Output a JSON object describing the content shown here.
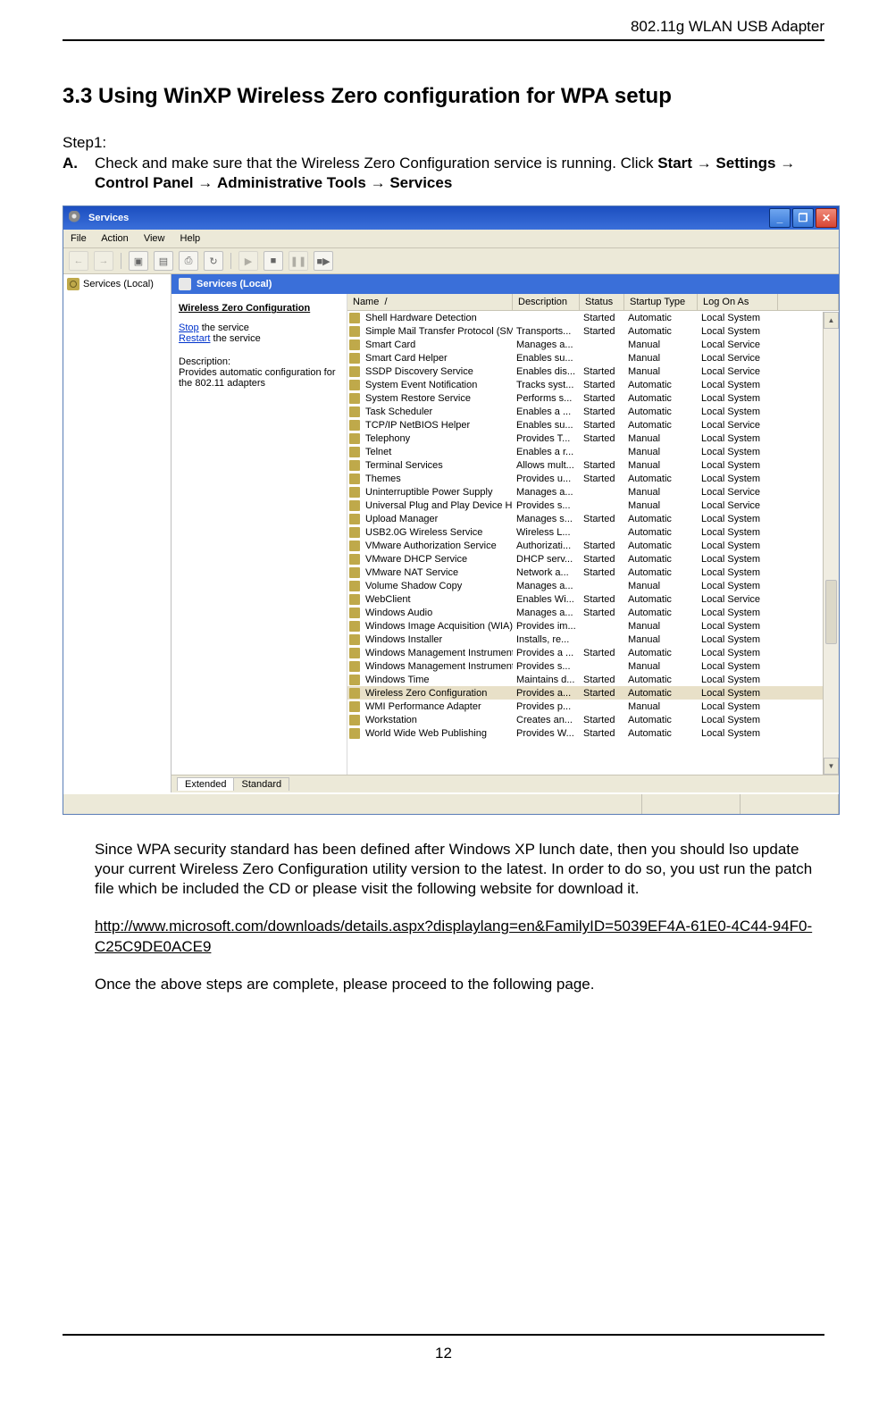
{
  "doc": {
    "header_right": "802.11g WLAN USB Adapter",
    "section_title": "3.3 Using WinXP Wireless Zero configuration for WPA setup",
    "step_label": "Step1:",
    "bullet": "A.",
    "instr_prefix": "Check and make sure that the Wireless Zero Configuration service is running. Click ",
    "path1": "Start",
    "arrow": "→",
    "path2": "Settings",
    "path3": "Control Panel",
    "path4": "Administrative Tools",
    "path5": "Services",
    "para2": "Since WPA security standard has been defined after Windows XP lunch date, then you should lso update your current Wireless Zero Configuration utility version to the latest. In order to do so, you ust run the patch file which be included the CD or please visit the following website for download it.",
    "url": "http://www.microsoft.com/downloads/details.aspx?displaylang=en&FamilyID=5039EF4A-61E0-4C44-94F0-C25C9DE0ACE9",
    "para3": "Once the above steps are complete, please proceed to the following page.",
    "page_number": "12"
  },
  "win": {
    "title": "Services",
    "menu": {
      "file": "File",
      "action": "Action",
      "view": "View",
      "help": "Help"
    },
    "tree_label": "Services (Local)",
    "panel_title": "Services (Local)",
    "info": {
      "selected": "Wireless Zero Configuration",
      "link_stop": "Stop",
      "link_stop_suffix": " the service",
      "link_restart": "Restart",
      "link_restart_suffix": " the service",
      "desc_label": "Description:",
      "desc_text": "Provides automatic configuration for the 802.11 adapters"
    },
    "columns": {
      "name": "Name",
      "sort": "/",
      "desc": "Description",
      "status": "Status",
      "startup": "Startup Type",
      "logon": "Log On As"
    },
    "tabs": {
      "extended": "Extended",
      "standard": "Standard"
    },
    "services": [
      {
        "name": "Shell Hardware Detection",
        "desc": "",
        "status": "Started",
        "startup": "Automatic",
        "logon": "Local System"
      },
      {
        "name": "Simple Mail Transfer Protocol (SMTP)",
        "desc": "Transports...",
        "status": "Started",
        "startup": "Automatic",
        "logon": "Local System"
      },
      {
        "name": "Smart Card",
        "desc": "Manages a...",
        "status": "",
        "startup": "Manual",
        "logon": "Local Service"
      },
      {
        "name": "Smart Card Helper",
        "desc": "Enables su...",
        "status": "",
        "startup": "Manual",
        "logon": "Local Service"
      },
      {
        "name": "SSDP Discovery Service",
        "desc": "Enables dis...",
        "status": "Started",
        "startup": "Manual",
        "logon": "Local Service"
      },
      {
        "name": "System Event Notification",
        "desc": "Tracks syst...",
        "status": "Started",
        "startup": "Automatic",
        "logon": "Local System"
      },
      {
        "name": "System Restore Service",
        "desc": "Performs s...",
        "status": "Started",
        "startup": "Automatic",
        "logon": "Local System"
      },
      {
        "name": "Task Scheduler",
        "desc": "Enables a ...",
        "status": "Started",
        "startup": "Automatic",
        "logon": "Local System"
      },
      {
        "name": "TCP/IP NetBIOS Helper",
        "desc": "Enables su...",
        "status": "Started",
        "startup": "Automatic",
        "logon": "Local Service"
      },
      {
        "name": "Telephony",
        "desc": "Provides T...",
        "status": "Started",
        "startup": "Manual",
        "logon": "Local System"
      },
      {
        "name": "Telnet",
        "desc": "Enables a r...",
        "status": "",
        "startup": "Manual",
        "logon": "Local System"
      },
      {
        "name": "Terminal Services",
        "desc": "Allows mult...",
        "status": "Started",
        "startup": "Manual",
        "logon": "Local System"
      },
      {
        "name": "Themes",
        "desc": "Provides u...",
        "status": "Started",
        "startup": "Automatic",
        "logon": "Local System"
      },
      {
        "name": "Uninterruptible Power Supply",
        "desc": "Manages a...",
        "status": "",
        "startup": "Manual",
        "logon": "Local Service"
      },
      {
        "name": "Universal Plug and Play Device Host",
        "desc": "Provides s...",
        "status": "",
        "startup": "Manual",
        "logon": "Local Service"
      },
      {
        "name": "Upload Manager",
        "desc": "Manages s...",
        "status": "Started",
        "startup": "Automatic",
        "logon": "Local System"
      },
      {
        "name": "USB2.0G Wireless Service",
        "desc": "Wireless L...",
        "status": "",
        "startup": "Automatic",
        "logon": "Local System"
      },
      {
        "name": "VMware Authorization Service",
        "desc": "Authorizati...",
        "status": "Started",
        "startup": "Automatic",
        "logon": "Local System"
      },
      {
        "name": "VMware DHCP Service",
        "desc": "DHCP serv...",
        "status": "Started",
        "startup": "Automatic",
        "logon": "Local System"
      },
      {
        "name": "VMware NAT Service",
        "desc": "Network a...",
        "status": "Started",
        "startup": "Automatic",
        "logon": "Local System"
      },
      {
        "name": "Volume Shadow Copy",
        "desc": "Manages a...",
        "status": "",
        "startup": "Manual",
        "logon": "Local System"
      },
      {
        "name": "WebClient",
        "desc": "Enables Wi...",
        "status": "Started",
        "startup": "Automatic",
        "logon": "Local Service"
      },
      {
        "name": "Windows Audio",
        "desc": "Manages a...",
        "status": "Started",
        "startup": "Automatic",
        "logon": "Local System"
      },
      {
        "name": "Windows Image Acquisition (WIA)",
        "desc": "Provides im...",
        "status": "",
        "startup": "Manual",
        "logon": "Local System"
      },
      {
        "name": "Windows Installer",
        "desc": "Installs, re...",
        "status": "",
        "startup": "Manual",
        "logon": "Local System"
      },
      {
        "name": "Windows Management Instrumenta...",
        "desc": "Provides a ...",
        "status": "Started",
        "startup": "Automatic",
        "logon": "Local System"
      },
      {
        "name": "Windows Management Instrumenta...",
        "desc": "Provides s...",
        "status": "",
        "startup": "Manual",
        "logon": "Local System"
      },
      {
        "name": "Windows Time",
        "desc": "Maintains d...",
        "status": "Started",
        "startup": "Automatic",
        "logon": "Local System"
      },
      {
        "name": "Wireless Zero Configuration",
        "desc": "Provides a...",
        "status": "Started",
        "startup": "Automatic",
        "logon": "Local System",
        "selected": true
      },
      {
        "name": "WMI Performance Adapter",
        "desc": "Provides p...",
        "status": "",
        "startup": "Manual",
        "logon": "Local System"
      },
      {
        "name": "Workstation",
        "desc": "Creates an...",
        "status": "Started",
        "startup": "Automatic",
        "logon": "Local System"
      },
      {
        "name": "World Wide Web Publishing",
        "desc": "Provides W...",
        "status": "Started",
        "startup": "Automatic",
        "logon": "Local System"
      }
    ]
  }
}
